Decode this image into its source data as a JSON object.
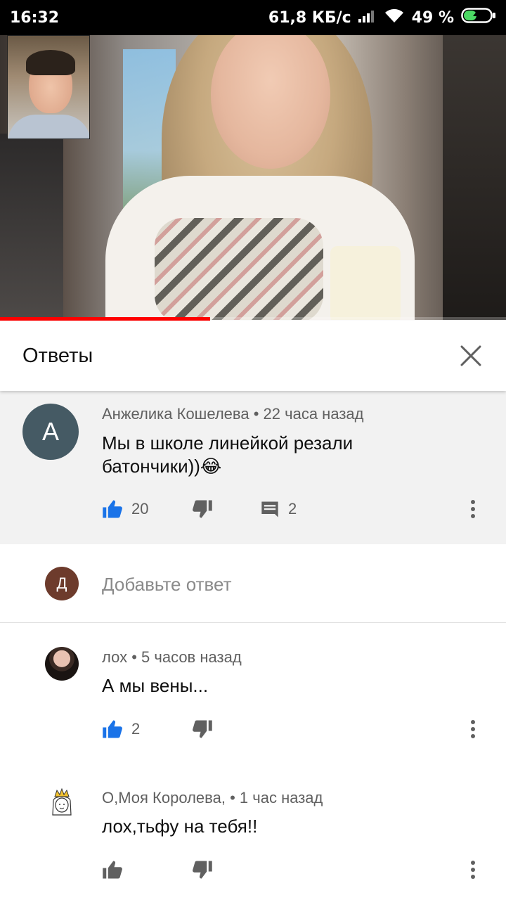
{
  "status_bar": {
    "time": "16:32",
    "network_speed": "61,8 КБ/с",
    "battery_percent": "49 %",
    "battery_level": 0.49
  },
  "video": {
    "progress": 0.415
  },
  "panel": {
    "title": "Ответы"
  },
  "parent_comment": {
    "avatar_letter": "А",
    "avatar_color": "#455a64",
    "author": "Анжелика Кошелева",
    "time": "22 часа назад",
    "text": "Мы в школе линейкой резали батончики))",
    "emoji": "😂",
    "likes": "20",
    "replies": "2"
  },
  "add_reply": {
    "avatar_letter": "Д",
    "avatar_color": "#6d3b2c",
    "placeholder": "Добавьте ответ"
  },
  "replies": [
    {
      "author": "лох",
      "time": "5 часов назад",
      "text": "А мы вены...",
      "likes": "2",
      "liked": true
    },
    {
      "author": "О,Моя Королева,",
      "time": "1 час назад",
      "text": "лох,тьфу на тебя!!",
      "likes": "",
      "liked": false
    }
  ],
  "colors": {
    "accent_red": "#ff0000",
    "like_blue": "#1a73e8",
    "icon_gray": "#606060"
  }
}
